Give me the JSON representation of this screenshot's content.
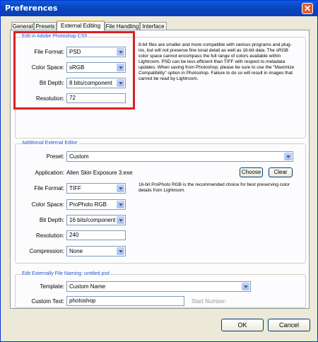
{
  "window": {
    "title": "Preferences"
  },
  "tabs": [
    {
      "label": "General"
    },
    {
      "label": "Presets"
    },
    {
      "label": "External Editing"
    },
    {
      "label": "File Handling"
    },
    {
      "label": "Interface"
    }
  ],
  "photoshop": {
    "legend": "Edit in Adobe Photoshop CS5",
    "file_format_label": "File Format:",
    "file_format_value": "PSD",
    "color_space_label": "Color Space:",
    "color_space_value": "sRGB",
    "bit_depth_label": "Bit Depth:",
    "bit_depth_value": "8 bits/component",
    "resolution_label": "Resolution:",
    "resolution_value": "72",
    "info": "8-bit files are smaller and more compatible with various programs and plug-ins, but will not preserve fine tonal detail as well as 16-bit data. The sRGB color space cannot encompass the full range of colors available within Lightroom. PSD can be less efficient than TIFF with respect to metadata updates. When saving from Photoshop, please be sure to use the \"Maximize Compatibility\" option in Photoshop. Failure to do so will result in images that cannot be read by Lightroom."
  },
  "additional": {
    "legend": "Additional External Editor",
    "preset_label": "Preset:",
    "preset_value": "Custom",
    "application_label": "Application:",
    "application_value": "Alien Skin Exposure 3.exe",
    "choose_label": "Choose",
    "clear_label": "Clear",
    "file_format_label": "File Format:",
    "file_format_value": "TIFF",
    "color_space_label": "Color Space:",
    "color_space_value": "ProPhoto RGB",
    "bit_depth_label": "Bit Depth:",
    "bit_depth_value": "16 bits/component",
    "resolution_label": "Resolution:",
    "resolution_value": "240",
    "compression_label": "Compression:",
    "compression_value": "None",
    "info": "16-bit ProPhoto RGB is the recommended choice for best preserving color details from Lightroom."
  },
  "naming": {
    "legend": "Edit Externally File Naming:  untitled.psd",
    "template_label": "Template:",
    "template_value": "Custom Name",
    "custom_text_label": "Custom Text:",
    "custom_text_value": "photoshop",
    "start_number_label": "Start Number:"
  },
  "buttons": {
    "ok": "OK",
    "cancel": "Cancel"
  },
  "colors": {
    "titlebar": "#0a4fd0",
    "highlight": "#dd1f25",
    "legend": "#2456c8"
  }
}
